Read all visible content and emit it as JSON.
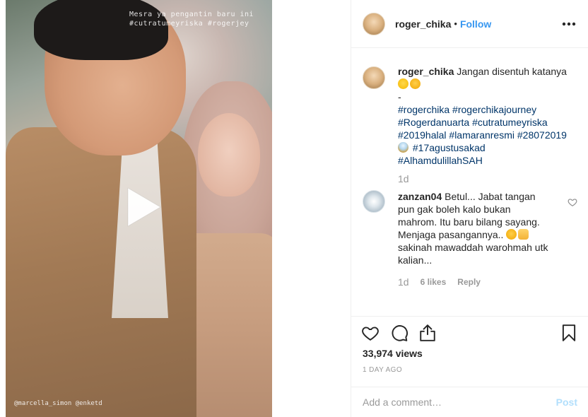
{
  "media": {
    "overlay_line1": "Mesra ya pengantin baru ini",
    "overlay_line2": "#cutratumeyriska #rogerjey",
    "credit": "@marcella_simon @enketd"
  },
  "post": {
    "username": "roger_chika",
    "separator": "•",
    "follow_label": "Follow"
  },
  "caption": {
    "username": "roger_chika",
    "text": "Jangan disentuh katanya",
    "dash": "-",
    "hashtags_line1": [
      "#rogerchika",
      "#rogerchikajourney"
    ],
    "hashtags_line2": [
      "#Rogerdanuarta",
      "#cutratumeyriska"
    ],
    "hashtags_line3": [
      "#2019halal",
      "#lamaranresmi",
      "#28072019"
    ],
    "hashtags_line4": [
      "#17agustusakad"
    ],
    "hashtags_line5": [
      "#AlhamdulillahSAH"
    ],
    "time": "1d"
  },
  "comment": {
    "username": "zanzan04",
    "text_line1": "Betul... Jabat tangan",
    "text_line2": "pun gak boleh kalo bukan",
    "text_line3": "mahrom. Itu baru bilang sayang.",
    "text_line4": "Menjaga pasangannya..",
    "text_line5": "sakinah mawaddah warohmah utk",
    "text_line6": "kalian...",
    "time": "1d",
    "likes": "6 likes",
    "reply_label": "Reply"
  },
  "stats": {
    "views": "33,974 views",
    "posted": "1 DAY AGO"
  },
  "add_comment": {
    "placeholder": "Add a comment…",
    "post_label": "Post"
  },
  "colors": {
    "accent": "#3897f0",
    "hashtag": "#003569",
    "muted": "#999999",
    "post_disabled": "#b2dffc"
  },
  "icons": {
    "play": "play-icon",
    "more": "more-options-icon",
    "like": "heart-icon",
    "comment": "comment-icon",
    "share": "share-icon",
    "save": "bookmark-icon",
    "comment_like": "heart-small-icon"
  }
}
